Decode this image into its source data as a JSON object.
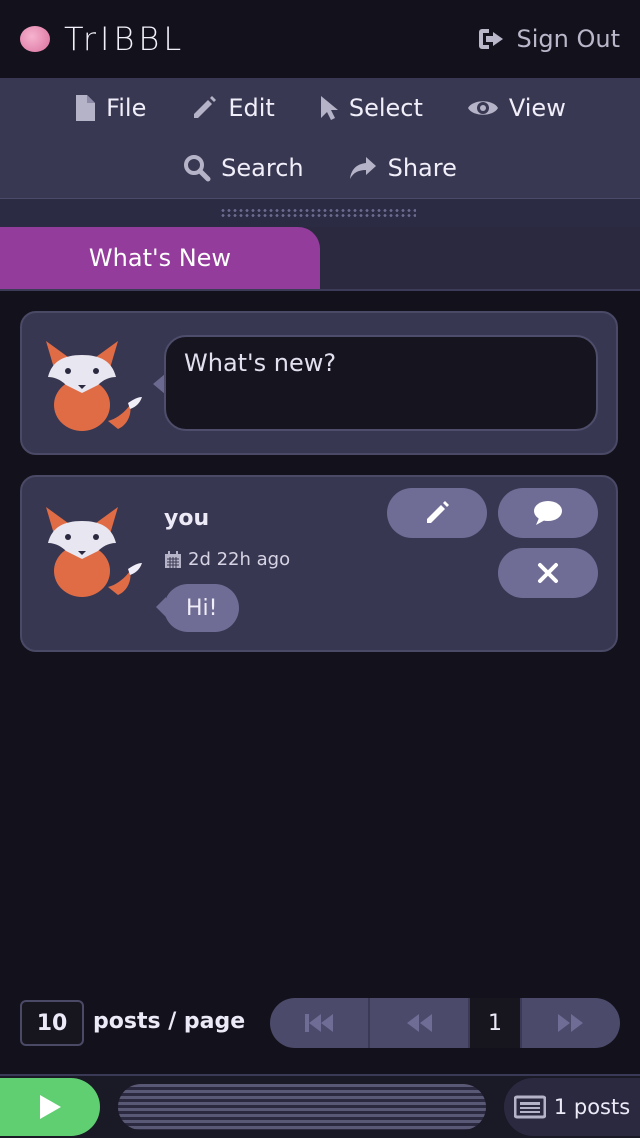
{
  "app": {
    "title": "TrIBBL",
    "sign_out": "Sign Out"
  },
  "menu": {
    "items": [
      {
        "label": "File",
        "icon": "file-icon"
      },
      {
        "label": "Edit",
        "icon": "pencil-icon"
      },
      {
        "label": "Select",
        "icon": "cursor-icon"
      },
      {
        "label": "View",
        "icon": "eye-icon"
      },
      {
        "label": "Search",
        "icon": "search-icon"
      },
      {
        "label": "Share",
        "icon": "share-icon"
      }
    ]
  },
  "tabs": [
    {
      "label": "What's New",
      "active": true
    }
  ],
  "compose": {
    "placeholder": "What's new?"
  },
  "posts": [
    {
      "author": "you",
      "time": "2d 22h ago",
      "message": "Hi!"
    }
  ],
  "pagination": {
    "per_page": "10",
    "per_page_label": "posts / page",
    "current_page": "1"
  },
  "footer": {
    "post_count": "1 posts"
  },
  "colors": {
    "accent": "#943c9c",
    "menu_bg": "#393853",
    "play": "#5fcf72",
    "pill": "#6f6d95"
  }
}
